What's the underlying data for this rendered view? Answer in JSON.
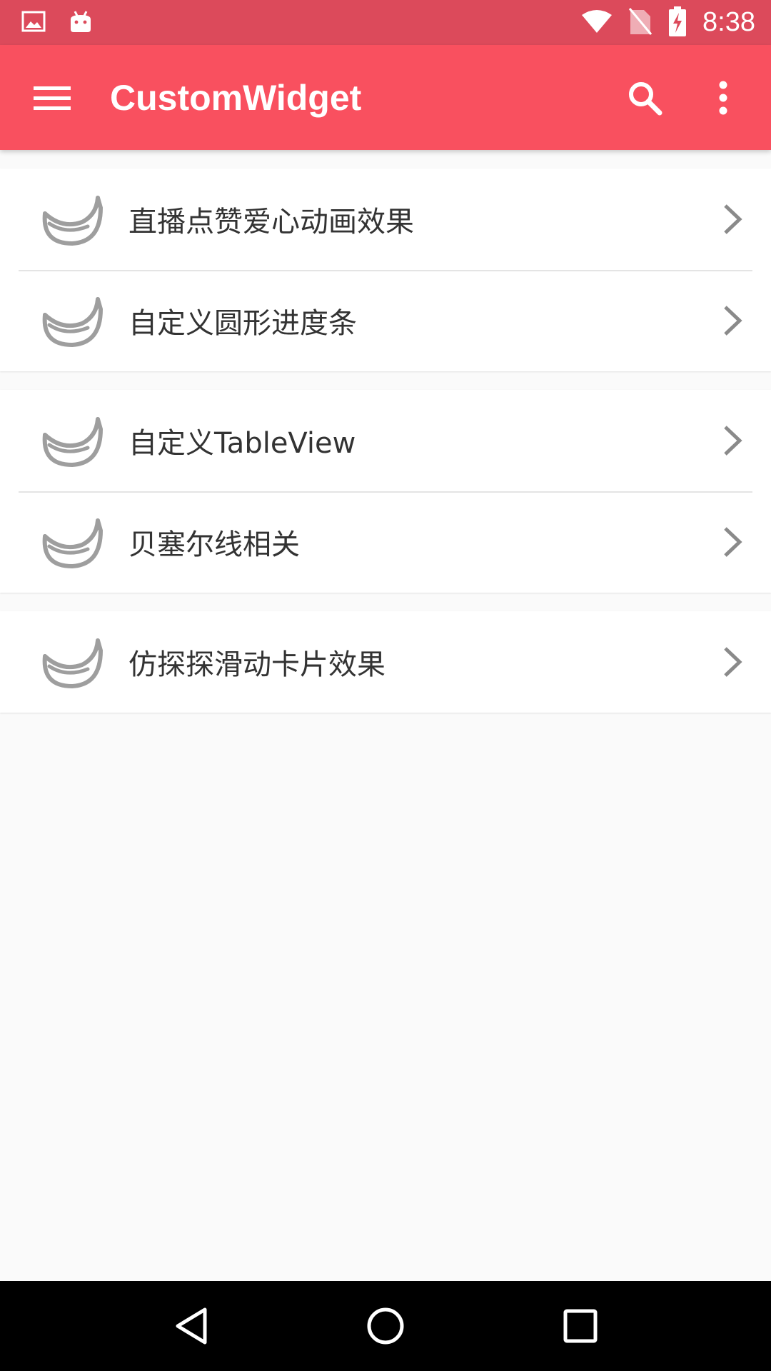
{
  "status_bar": {
    "time": "8:38",
    "icons": [
      "image-icon",
      "android-icon",
      "wifi-icon",
      "no-sim-icon",
      "battery-charging-icon"
    ]
  },
  "app_bar": {
    "title": "CustomWidget",
    "icons": [
      "menu-icon",
      "search-icon",
      "more-vert-icon"
    ]
  },
  "list": {
    "groups": [
      {
        "items": [
          {
            "label": "直播点赞爱心动画效果",
            "icon": "banana-icon"
          },
          {
            "label": "自定义圆形进度条",
            "icon": "banana-icon"
          }
        ]
      },
      {
        "items": [
          {
            "label": "自定义TableView",
            "icon": "banana-icon"
          },
          {
            "label": "贝塞尔线相关",
            "icon": "banana-icon"
          }
        ]
      },
      {
        "items": [
          {
            "label": "仿探探滑动卡片效果",
            "icon": "banana-icon"
          }
        ]
      }
    ]
  },
  "nav_bar": {
    "icons": [
      "back-icon",
      "home-icon",
      "recents-icon"
    ]
  },
  "colors": {
    "status_bar": "#dc4a5b",
    "app_bar": "#f9505f",
    "background": "#fafafa",
    "icon_gray": "#9e9e9e"
  }
}
